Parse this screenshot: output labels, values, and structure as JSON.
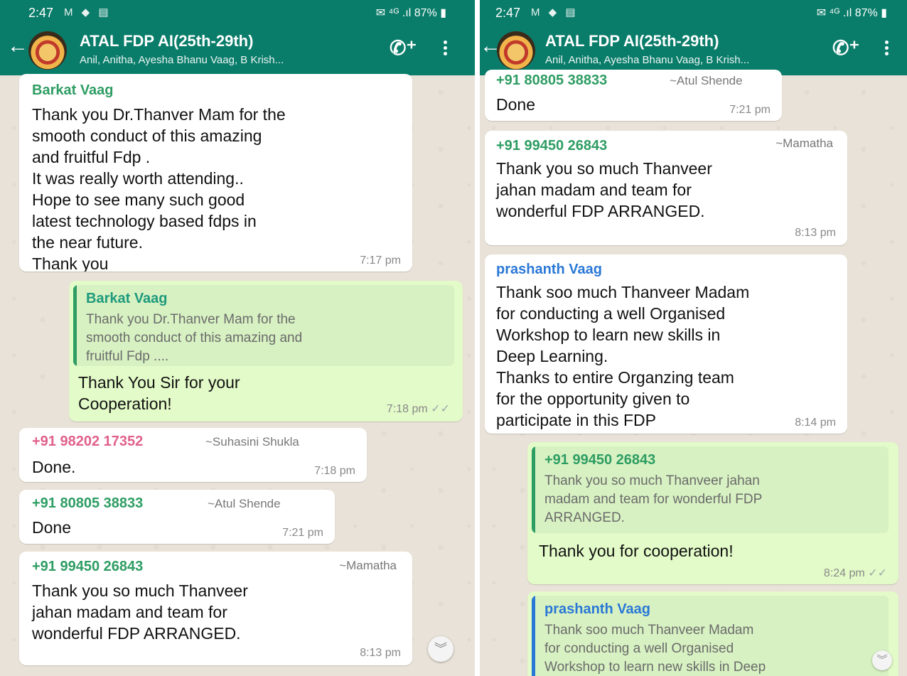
{
  "statusbar": {
    "time": "2:47",
    "battery": "87%",
    "left_icons": "M ◆ ▤",
    "right_icons": "✉ ⁴ᴳ .ıl"
  },
  "chat": {
    "title": "ATAL FDP AI(25th-29th)",
    "subtitle": "Anil, Anitha, Ayesha Bhanu Vaag, B Krish..."
  },
  "left": {
    "m1": {
      "sender": "Barkat Vaag",
      "lines": [
        "Thank you Dr.Thanver Mam for the",
        "smooth conduct of this amazing",
        "and  fruitful Fdp .",
        "It was really worth attending..",
        "Hope to see many such good",
        "latest technology based  fdps in",
        "the near future.",
        "Thank you"
      ],
      "time": "7:17 pm"
    },
    "m2": {
      "quote_name": "Barkat Vaag",
      "quote_lines": [
        "Thank you Dr.Thanver Mam for the",
        "smooth conduct of this amazing and",
        "fruitful Fdp ...."
      ],
      "lines": [
        "Thank You Sir for your",
        "Cooperation!"
      ],
      "time": "7:18 pm",
      "ticks": "✓✓"
    },
    "m3": {
      "sender": "+91 98202 17352",
      "alias": "~Suhasini Shukla",
      "text": "Done.",
      "time": "7:18 pm"
    },
    "m4": {
      "sender": "+91 80805 38833",
      "alias": "~Atul Shende",
      "text": "Done",
      "time": "7:21 pm"
    },
    "m5": {
      "sender": "+91 99450 26843",
      "alias": "~Mamatha",
      "lines": [
        "Thank you so much Thanveer",
        "jahan madam and team for",
        "wonderful FDP ARRANGED."
      ],
      "time": "8:13 pm"
    }
  },
  "right": {
    "m1": {
      "sender": "+91 80805 38833",
      "alias": "~Atul Shende",
      "text": "Done",
      "time": "7:21 pm"
    },
    "m2": {
      "sender": "+91 99450 26843",
      "alias": "~Mamatha",
      "lines": [
        "Thank you so much Thanveer",
        "jahan madam and team for",
        "wonderful FDP ARRANGED."
      ],
      "time": "8:13 pm"
    },
    "m3": {
      "sender": "prashanth Vaag",
      "lines": [
        "Thank soo much Thanveer Madam",
        "for conducting a well Organised",
        "Workshop to learn new skills in",
        "Deep Learning.",
        "Thanks to entire Organzing team",
        "for the opportunity given to",
        "participate in this FDP"
      ],
      "time": "8:14 pm"
    },
    "m4": {
      "quote_name": "+91 99450 26843",
      "quote_lines": [
        "Thank you so much Thanveer jahan",
        "madam and team for wonderful FDP",
        "ARRANGED."
      ],
      "text": "Thank you for cooperation!",
      "time": "8:24 pm",
      "ticks": "✓✓"
    },
    "m5": {
      "quote_name": "prashanth Vaag",
      "quote_lines": [
        "Thank soo much Thanveer Madam",
        "for conducting a well Organised",
        "Workshop to learn new skills in Deep"
      ]
    }
  },
  "icons": {
    "back": "back-arrow-icon",
    "call": "add-call-icon",
    "menu": "more-vert-icon",
    "scroll": "double-chevron-down-icon"
  },
  "colors": {
    "header": "#0a7d6a",
    "outgoing": "#e3fbc8",
    "incoming": "#ffffff",
    "name_green": "#2e9d63",
    "name_pink": "#e0608a",
    "name_blue": "#2a78d6"
  }
}
